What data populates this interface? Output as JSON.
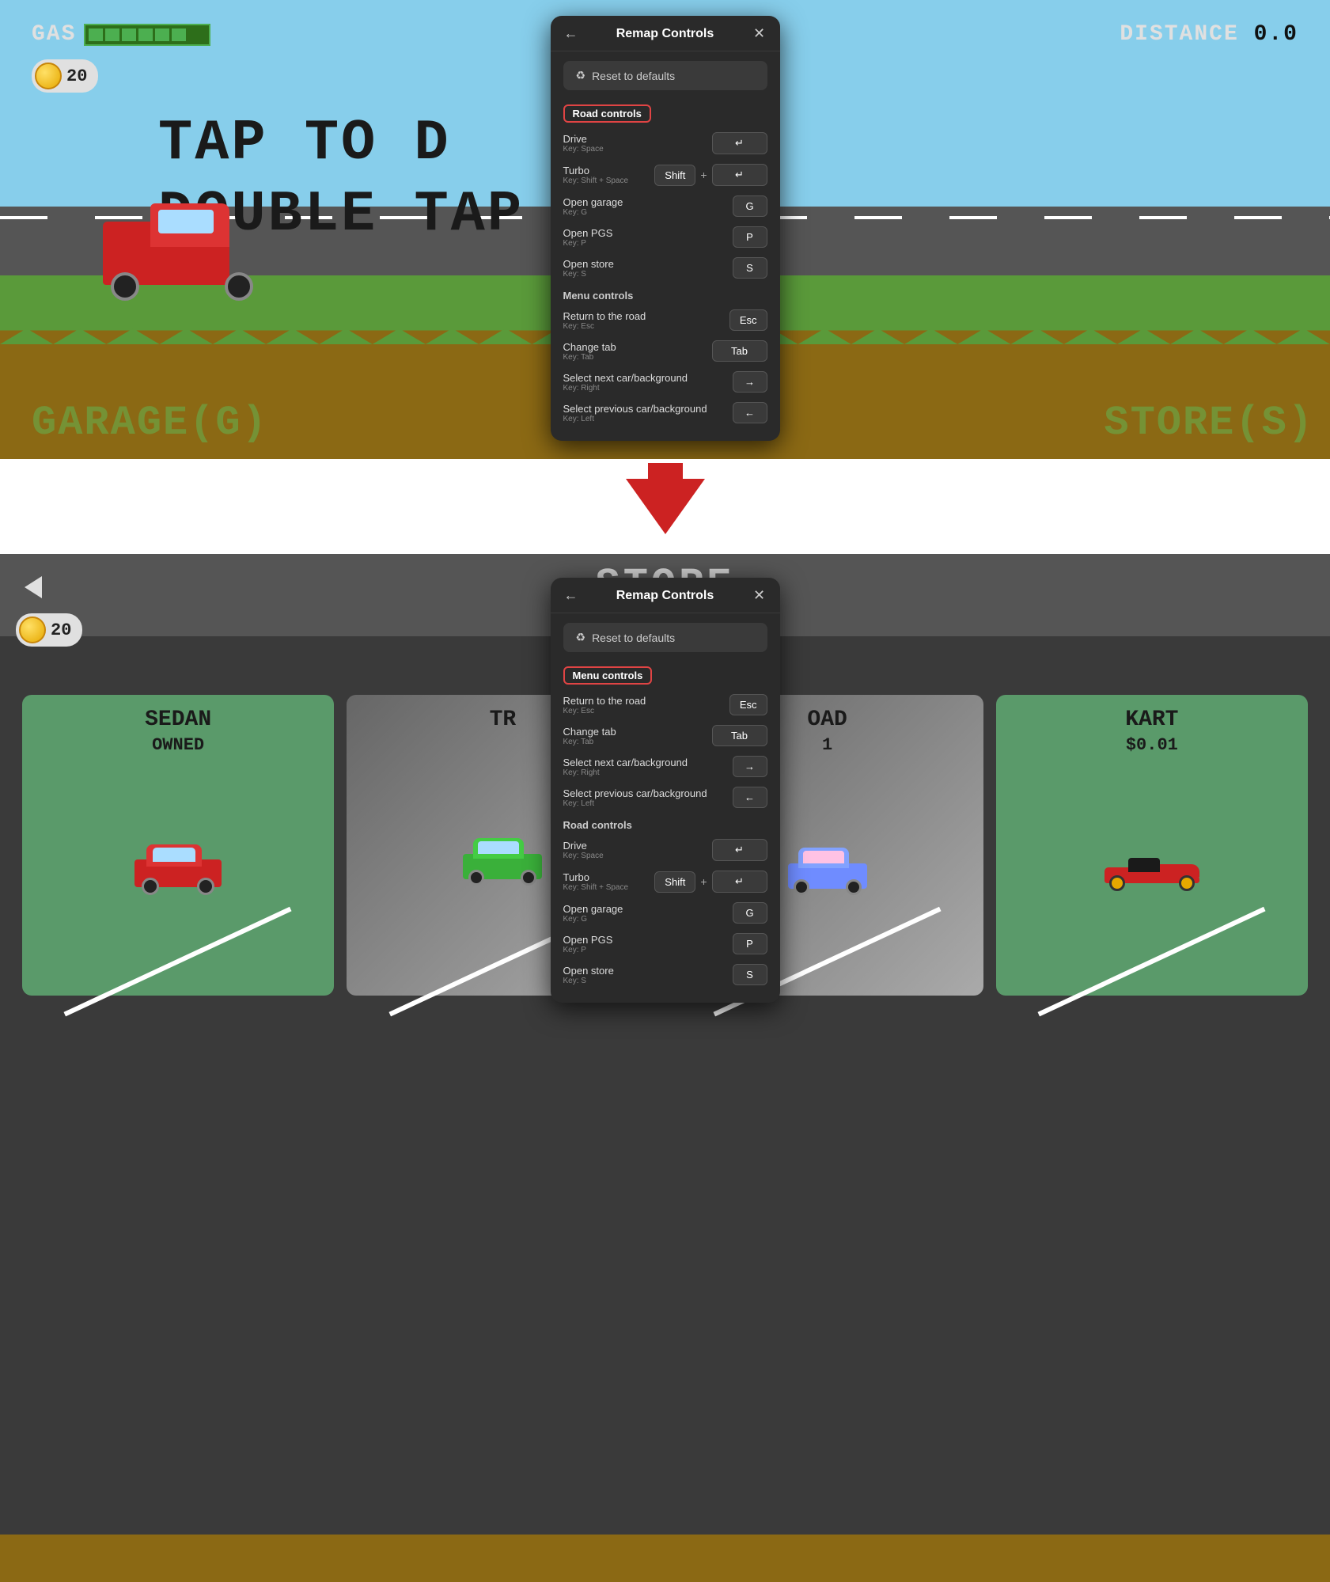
{
  "top": {
    "gas_label": "GAS",
    "distance_label": "DISTANCE",
    "distance_value": "0.0",
    "coin_count": "20",
    "tap_text": "TAP TO D",
    "double_tap_text": "DOUBLE TAP",
    "garage_text": "GARAGE(G)",
    "store_text": "STORE(S)"
  },
  "modal_top": {
    "title": "Remap Controls",
    "reset_label": "Reset to defaults",
    "section1": "Road controls",
    "drive_label": "Drive",
    "drive_key_hint": "Key: Space",
    "drive_key": "↵",
    "turbo_label": "Turbo",
    "turbo_key_hint": "Key: Shift + Space",
    "turbo_key1": "Shift",
    "turbo_key2": "↵",
    "open_garage_label": "Open garage",
    "open_garage_key_hint": "Key: G",
    "open_garage_key": "G",
    "open_pgs_label": "Open PGS",
    "open_pgs_key_hint": "Key: P",
    "open_pgs_key": "P",
    "open_store_label": "Open store",
    "open_store_key_hint": "Key: S",
    "open_store_key": "S",
    "section2": "Menu controls",
    "return_road_label": "Return to the road",
    "return_road_key_hint": "Key: Esc",
    "return_road_key": "Esc",
    "change_tab_label": "Change tab",
    "change_tab_key_hint": "Key: Tab",
    "change_tab_key": "Tab",
    "select_next_label": "Select next car/background",
    "select_next_key_hint": "Key: Right",
    "select_next_key": "→",
    "select_prev_label": "Select previous car/background",
    "select_prev_key_hint": "Key: Left",
    "select_prev_key": "←"
  },
  "arrow": {
    "direction": "down"
  },
  "bottom": {
    "store_title": "STORE",
    "coin_count": "20",
    "car1_title": "SEDAN",
    "car1_subtitle": "OWNED",
    "car2_title": "TR",
    "car2_subtitle": "",
    "car2_price": "",
    "car3_title": "OAD",
    "car3_price": "1",
    "car4_title": "KART",
    "car4_price": "$0.01"
  },
  "modal_bottom": {
    "title": "Remap Controls",
    "reset_label": "Reset to defaults",
    "section1": "Menu controls",
    "return_road_label": "Return to the road",
    "return_road_key_hint": "Key: Esc",
    "return_road_key": "Esc",
    "change_tab_label": "Change tab",
    "change_tab_key_hint": "Key: Tab",
    "change_tab_key": "Tab",
    "select_next_label": "Select next car/background",
    "select_next_key_hint": "Key: Right",
    "select_next_key": "→",
    "select_prev_label": "Select previous car/background",
    "select_prev_key_hint": "Key: Left",
    "select_prev_key": "←",
    "section2": "Road controls",
    "drive_label": "Drive",
    "drive_key_hint": "Key: Space",
    "drive_key": "↵",
    "turbo_label": "Turbo",
    "turbo_key_hint": "Key: Shift + Space",
    "turbo_key1": "Shift",
    "turbo_key2": "↵",
    "open_garage_label": "Open garage",
    "open_garage_key_hint": "Key: G",
    "open_garage_key": "G",
    "open_pgs_label": "Open PGS",
    "open_pgs_key_hint": "Key: P",
    "open_pgs_key": "P",
    "open_store_label": "Open store",
    "open_store_key_hint": "Key: S",
    "open_store_key": "S"
  }
}
